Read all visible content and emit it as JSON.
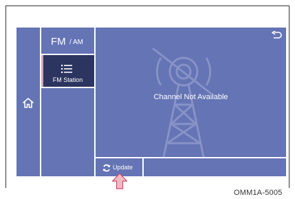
{
  "screen": {
    "band_label": "FM",
    "band_sub": "/ AM",
    "station_menu_label": "FM Station",
    "message": "Channel Not Available",
    "update_label": "Update",
    "figure_code": "OMM1A-5005"
  },
  "icons": {
    "home": "home-icon",
    "list": "list-icon",
    "back": "back-arrow-icon",
    "refresh": "refresh-icon",
    "antenna": "antenna-tower-icon",
    "pointer": "up-arrow-pointer-icon"
  },
  "colors": {
    "panel": "#6474b4",
    "selected": "#2c3560",
    "accent": "#d4a8b8",
    "pointer_fill": "#f3b9c5",
    "pointer_stroke": "#d04a6a"
  }
}
